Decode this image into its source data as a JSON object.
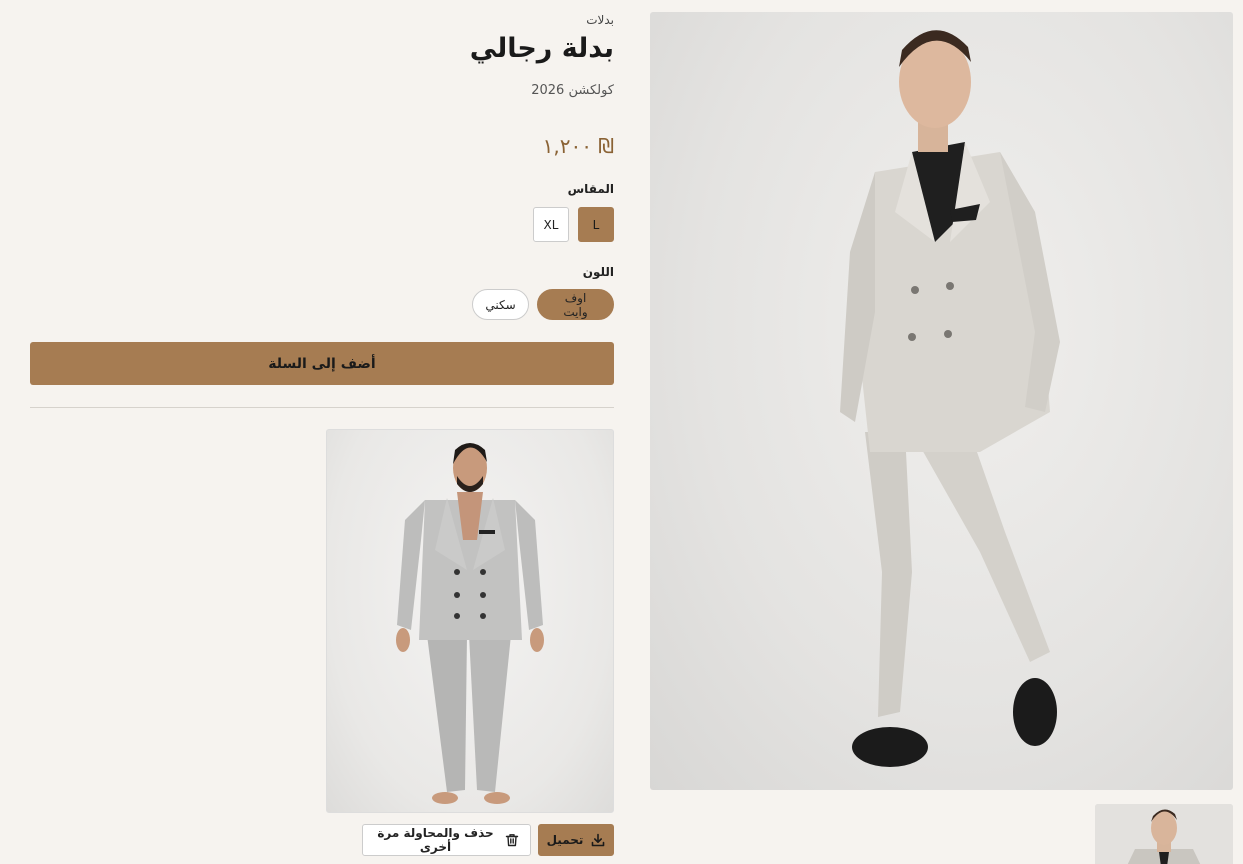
{
  "breadcrumb": "بدلات",
  "product": {
    "title": "بدلة رجالي",
    "collection": "كولكشن 2026",
    "price": "١,٢٠٠ ₪"
  },
  "size": {
    "label": "المقاس",
    "options": [
      "L",
      "XL"
    ],
    "selected": "L"
  },
  "color": {
    "label": "اللون",
    "options": [
      "اوف وايت",
      "سكني"
    ],
    "selected": "اوف وايت"
  },
  "add_to_cart_label": "أضف إلى السلة",
  "actions": {
    "download_label": "تحميل",
    "delete_retry_label": "حذف والمحاولة مرة أخرى"
  },
  "colors": {
    "accent": "#a67c52",
    "background": "#f6f3ef",
    "price": "#8a6234"
  }
}
